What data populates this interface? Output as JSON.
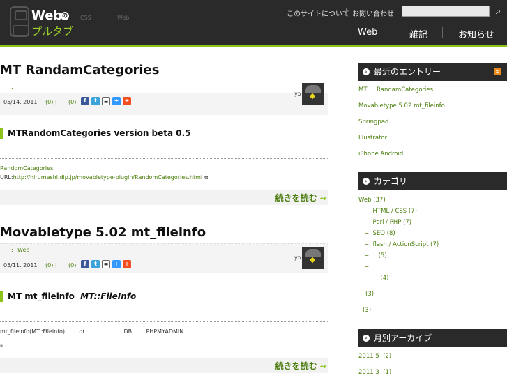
{
  "header": {
    "logo_main": "Web",
    "logo_badge": "の",
    "logo_sub": "プルタブ",
    "tagline_1": "CSS",
    "tagline_2": "Web",
    "top_links": [
      "このサイトについて",
      "お問い合わせ"
    ],
    "search_placeholder": "",
    "search_icon": "magnifier-icon",
    "nav": [
      "Web",
      "雑記",
      "お知らせ"
    ]
  },
  "posts": [
    {
      "title": "MT RandamCategories",
      "category_label": ":",
      "category": "",
      "date": "05/14. 2011 |",
      "comments": "(0) |",
      "trackbacks": "(0)",
      "author": "yo",
      "subheading": "MTRandomCategories version beta 0.5",
      "body_line1": "RandomCategories",
      "body_url_label": "URL:",
      "body_url": "http://hirumeshi.dip.jp/movabletype-plugin/RandomCategories.html",
      "external_icon": "external-link-icon",
      "more": "続きを読む"
    },
    {
      "title": "Movabletype 5.02 mt_fileinfo",
      "category_label": ":",
      "category": "Web",
      "date": "05/11. 2011 |",
      "comments": "(0) |",
      "trackbacks": "(0)",
      "author": "yo",
      "subheading_plain": "MT mt_fileinfo",
      "subheading_italic": "MT::FileInfo",
      "body_line1": "mt_fileinfo(MT::Fileinfo)        or                      DB        PHPMYADMIN",
      "body_line2": "*",
      "more": "続きを読む"
    }
  ],
  "share_icons": [
    "facebook-icon",
    "twitter-icon",
    "print-icon",
    "delicious-icon",
    "addthis-icon"
  ],
  "sidebar": {
    "recent_title": "最近のエントリー",
    "recent": [
      "MT     RandamCategories",
      "Movabletype 5.02 mt_fileinfo",
      "Springpad",
      "Illustrator",
      "iPhone Android"
    ],
    "category_title": "カテゴリ",
    "categories": [
      {
        "label": "Web (37)",
        "indent": 0
      },
      {
        "label": "HTML / CSS (7)",
        "indent": 1
      },
      {
        "label": "Perl / PHP (7)",
        "indent": 1
      },
      {
        "label": "SEO (8)",
        "indent": 1
      },
      {
        "label": "flash / ActionScript (7)",
        "indent": 1
      },
      {
        "label": "(5)",
        "indent": 1
      },
      {
        "label": "",
        "indent": 1
      },
      {
        "label": "(4)",
        "indent": 1
      },
      {
        "label": "(3)",
        "indent": 0
      },
      {
        "label": "(3)",
        "indent": 0
      }
    ],
    "archive_title": "月別アーカイブ",
    "archives": [
      "2011 5  (2)",
      "2011 3  (1)"
    ]
  }
}
